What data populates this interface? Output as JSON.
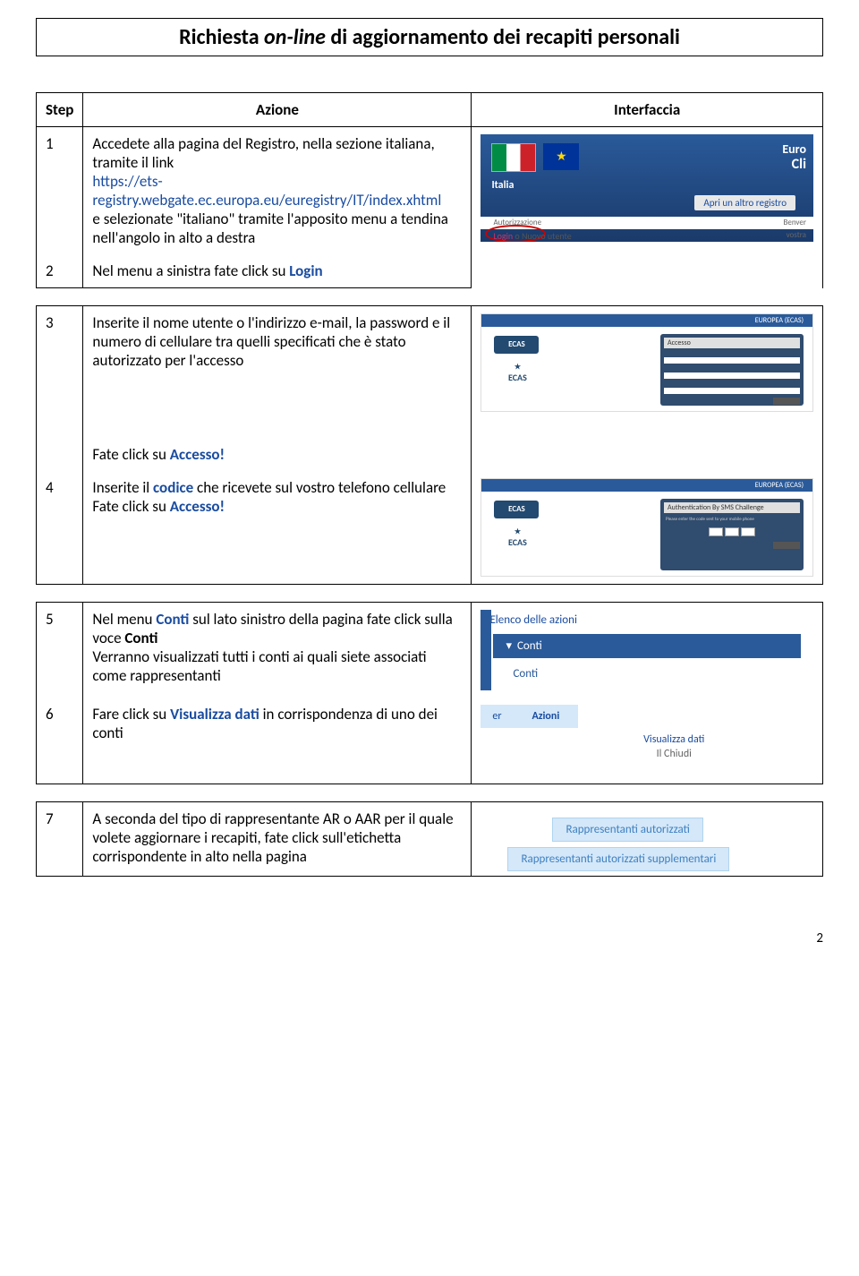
{
  "title": {
    "pre": "Richiesta ",
    "online": "on-line",
    "post": " di aggiornamento dei recapiti personali"
  },
  "headers": {
    "step": "Step",
    "azione": "Azione",
    "interfaccia": "Interfaccia"
  },
  "rows": {
    "r1": {
      "num": "1",
      "p1": "Accedete alla pagina del Registro, nella sezione italiana, tramite il link",
      "link": "https://ets-registry.webgate.ec.europa.eu/euregistry/IT/index.xhtml",
      "p2": "e selezionate \"italiano\" tramite l'apposito menu a tendina nell'angolo in alto a destra"
    },
    "r2": {
      "num": "2",
      "p1a": "Nel menu a sinistra fate click su ",
      "p1b": "Login",
      "interf": {
        "italia": "Italia",
        "euro": "Euro",
        "cli": "Cli",
        "apri": "Apri un altro registro",
        "auth": "Autorizzazione",
        "benv": "Benver",
        "vos": "vostra",
        "login": "Login",
        "o": " o ",
        "nuovo": "Nuovo utente"
      }
    },
    "r3": {
      "num": "3",
      "p1": "Inserite il nome utente o l'indirizzo e-mail, la password e il numero di cellulare tra quelli specificati che è stato autorizzato per l'accesso",
      "interf": {
        "ecas_top": "EUROPEA (ECAS)",
        "accesso": "Accesso"
      }
    },
    "r3b": {
      "p1a": "Fate click su ",
      "p1b": "Accesso!"
    },
    "r4": {
      "num": "4",
      "p1a": "Inserite il ",
      "p1b": "codice",
      "p1c": "  che ricevete sul vostro telefono cellulare",
      "p2a": "Fate click su ",
      "p2b": "Accesso!",
      "interf": {
        "ecas_top": "EUROPEA (ECAS)",
        "auth": "Authentication By SMS Challenge"
      }
    },
    "r5": {
      "num": "5",
      "p1a": "Nel menu ",
      "p1b": "Conti",
      "p1c": " sul lato sinistro della pagina fate click sulla voce ",
      "p1d": "Conti",
      "p2": "Verranno visualizzati tutti i conti ai quali siete associati come rappresentanti",
      "interf": {
        "header": "Elenco delle azioni",
        "menu": "Conti",
        "item": "Conti"
      }
    },
    "r6": {
      "num": "6",
      "p1a": "Fare click su ",
      "p1b": "Visualizza dati",
      "p1c": " in corrispondenza di uno dei conti",
      "interf": {
        "col1": "er",
        "col2": "Azioni",
        "viz": "Visualizza dati",
        "chiudi": "Il Chiudi"
      }
    },
    "r7": {
      "num": "7",
      "p1": "A seconda del tipo di rappresentante AR o AAR per il quale volete aggiornare i recapiti, fate click sull'etichetta corrispondente in alto nella pagina",
      "interf": {
        "btn1": "Rappresentanti autorizzati",
        "btn2": "Rappresentanti autorizzati supplementari"
      }
    }
  },
  "footer": "2"
}
